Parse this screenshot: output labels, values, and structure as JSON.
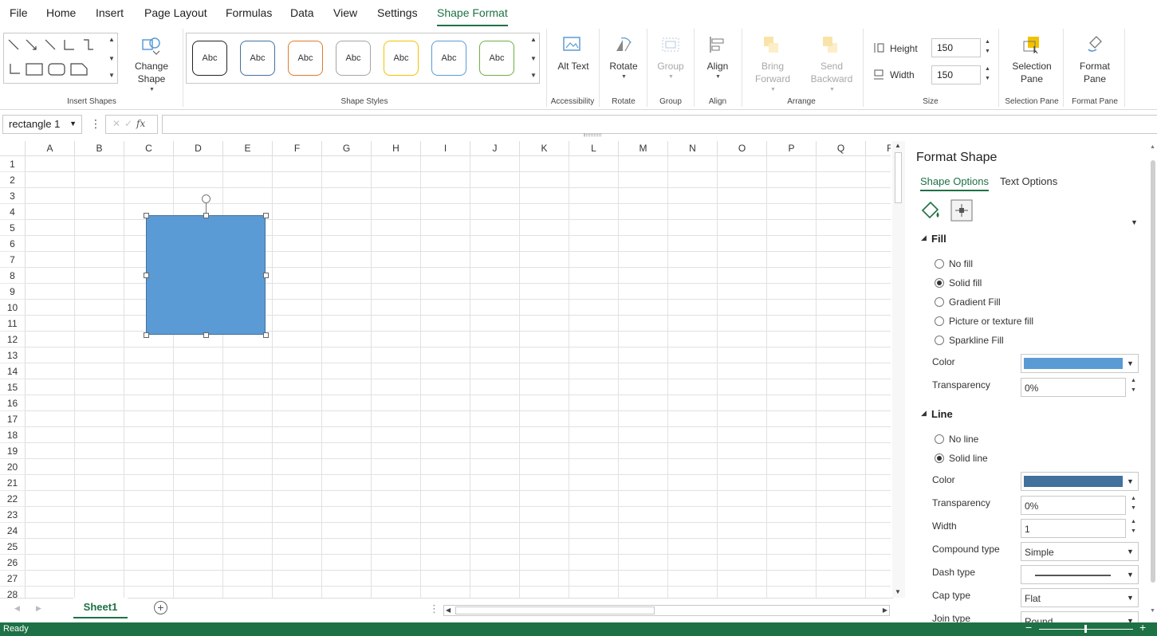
{
  "menu": {
    "items": [
      "File",
      "Home",
      "Insert",
      "Page Layout",
      "Formulas",
      "Data",
      "View",
      "Settings",
      "Shape Format"
    ],
    "active": "Shape Format"
  },
  "ribbon": {
    "insert_shapes_label": "Insert Shapes",
    "change_shape_line1": "Change",
    "change_shape_line2": "Shape",
    "shape_styles_label": "Shape Styles",
    "style_samples": [
      "Abc",
      "Abc",
      "Abc",
      "Abc",
      "Abc",
      "Abc",
      "Abc"
    ],
    "style_colors": [
      "#222222",
      "#41719c",
      "#e07b2a",
      "#a5a5a5",
      "#f2c200",
      "#5b9bd5",
      "#70ad47"
    ],
    "alt_text": "Alt Text",
    "accessibility_label": "Accessibility",
    "rotate": "Rotate",
    "rotate_label": "Rotate",
    "group": "Group",
    "group_label": "Group",
    "align": "Align",
    "align_label": "Align",
    "bring_forward_line1": "Bring",
    "bring_forward_line2": "Forward",
    "send_backward_line1": "Send",
    "send_backward_line2": "Backward",
    "arrange_label": "Arrange",
    "height_label": "Height",
    "height_value": "150",
    "width_label": "Width",
    "width_value": "150",
    "size_label": "Size",
    "selection_pane_line1": "Selection",
    "selection_pane_line2": "Pane",
    "selection_pane_label": "Selection Pane",
    "format_pane_line1": "Format",
    "format_pane_line2": "Pane",
    "format_pane_label": "Format Pane"
  },
  "formula_bar": {
    "name_box": "rectangle 1",
    "fx": "fx",
    "value": ""
  },
  "grid": {
    "columns": [
      "A",
      "B",
      "C",
      "D",
      "E",
      "F",
      "G",
      "H",
      "I",
      "J",
      "K",
      "L",
      "M",
      "N",
      "O",
      "P",
      "Q",
      "R"
    ],
    "rows": [
      "1",
      "2",
      "3",
      "4",
      "5",
      "6",
      "7",
      "8",
      "9",
      "10",
      "11",
      "12",
      "13",
      "14",
      "15",
      "16",
      "17",
      "18",
      "19",
      "20",
      "21",
      "22",
      "23",
      "24",
      "25",
      "26",
      "27",
      "28"
    ]
  },
  "shape": {
    "name": "rectangle 1",
    "fill_color": "#5b9bd5",
    "line_color": "#41719c"
  },
  "sheets": {
    "tabs": [
      "Sheet1"
    ],
    "active": "Sheet1"
  },
  "status": {
    "text": "Ready"
  },
  "format_pane": {
    "title": "Format Shape",
    "tabs": [
      "Shape Options",
      "Text Options"
    ],
    "active_tab": "Shape Options",
    "fill": {
      "heading": "Fill",
      "options": [
        "No fill",
        "Solid fill",
        "Gradient Fill",
        "Picture or texture fill",
        "Sparkline Fill"
      ],
      "selected": "Solid fill",
      "color_label": "Color",
      "color": "#5b9bd5",
      "transparency_label": "Transparency",
      "transparency": "0%"
    },
    "line": {
      "heading": "Line",
      "options": [
        "No line",
        "Solid line"
      ],
      "selected": "Solid line",
      "color_label": "Color",
      "color": "#41719c",
      "transparency_label": "Transparency",
      "transparency": "0%",
      "width_label": "Width",
      "width": "1",
      "compound_label": "Compound type",
      "compound": "Simple",
      "dash_label": "Dash type",
      "cap_label": "Cap type",
      "cap": "Flat",
      "join_label": "Join type",
      "join": "Round"
    }
  }
}
